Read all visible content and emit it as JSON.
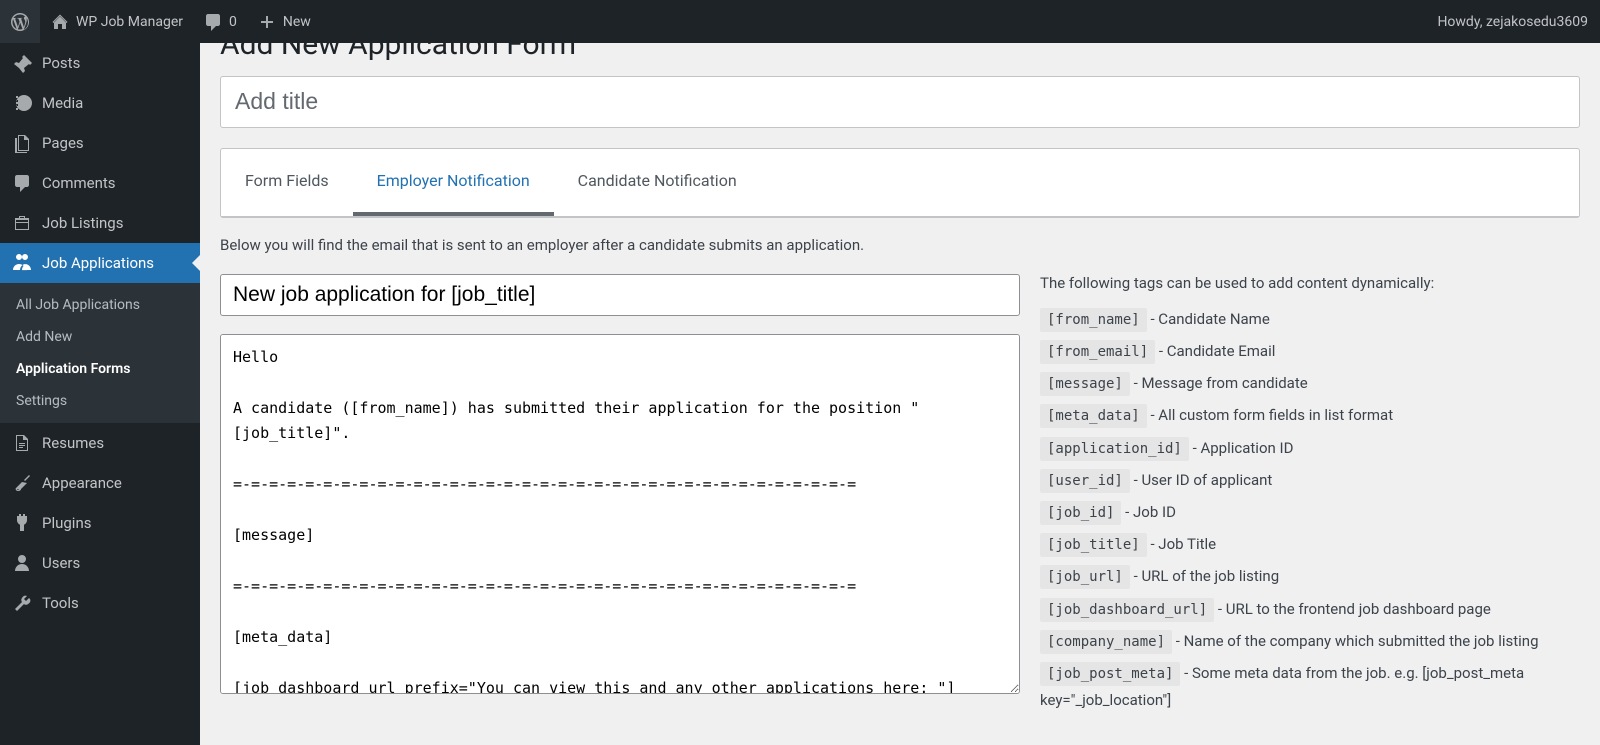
{
  "adminbar": {
    "site_name": "WP Job Manager",
    "comments_count": "0",
    "new_label": "New",
    "howdy": "Howdy, zejakosedu3609"
  },
  "sidebar": {
    "items": [
      {
        "icon": "pin",
        "label": "Posts"
      },
      {
        "icon": "media",
        "label": "Media"
      },
      {
        "icon": "pages",
        "label": "Pages"
      },
      {
        "icon": "comments",
        "label": "Comments"
      },
      {
        "icon": "briefcase",
        "label": "Job Listings"
      },
      {
        "icon": "groups",
        "label": "Job Applications",
        "current": true
      },
      {
        "icon": "doc",
        "label": "Resumes"
      },
      {
        "icon": "brush",
        "label": "Appearance"
      },
      {
        "icon": "plug",
        "label": "Plugins"
      },
      {
        "icon": "user",
        "label": "Users"
      },
      {
        "icon": "wrench",
        "label": "Tools"
      }
    ],
    "submenu": [
      {
        "label": "All Job Applications"
      },
      {
        "label": "Add New"
      },
      {
        "label": "Application Forms",
        "current": true
      },
      {
        "label": "Settings"
      }
    ]
  },
  "page": {
    "heading": "Add New Application Form",
    "title_placeholder": "Add title"
  },
  "tabs": [
    {
      "label": "Form Fields"
    },
    {
      "label": "Employer Notification",
      "active": true
    },
    {
      "label": "Candidate Notification"
    }
  ],
  "description": "Below you will find the email that is sent to an employer after a candidate submits an application.",
  "email": {
    "subject": "New job application for [job_title]",
    "body": "Hello\n\nA candidate ([from_name]) has submitted their application for the position \"[job_title]\".\n\n=-=-=-=-=-=-=-=-=-=-=-=-=-=-=-=-=-=-=-=-=-=-=-=-=-=-=-=-=-=-=-=-=-=-=\n\n[message]\n\n=-=-=-=-=-=-=-=-=-=-=-=-=-=-=-=-=-=-=-=-=-=-=-=-=-=-=-=-=-=-=-=-=-=-=\n\n[meta_data]\n\n[job_dashboard_url prefix=\"You can view this and any other applications here: \"]"
  },
  "tags": {
    "intro": "The following tags can be used to add content dynamically:",
    "list": [
      {
        "tag": "[from_name]",
        "desc": "Candidate Name"
      },
      {
        "tag": "[from_email]",
        "desc": "Candidate Email"
      },
      {
        "tag": "[message]",
        "desc": "Message from candidate"
      },
      {
        "tag": "[meta_data]",
        "desc": "All custom form fields in list format"
      },
      {
        "tag": "[application_id]",
        "desc": "Application ID"
      },
      {
        "tag": "[user_id]",
        "desc": "User ID of applicant"
      },
      {
        "tag": "[job_id]",
        "desc": "Job ID"
      },
      {
        "tag": "[job_title]",
        "desc": "Job Title"
      },
      {
        "tag": "[job_url]",
        "desc": "URL of the job listing"
      },
      {
        "tag": "[job_dashboard_url]",
        "desc": "URL to the frontend job dashboard page"
      },
      {
        "tag": "[company_name]",
        "desc": "Name of the company which submitted the job listing"
      },
      {
        "tag": "[job_post_meta]",
        "desc": "Some meta data from the job. e.g. [job_post_meta key=\"_job_location\"]"
      }
    ]
  }
}
